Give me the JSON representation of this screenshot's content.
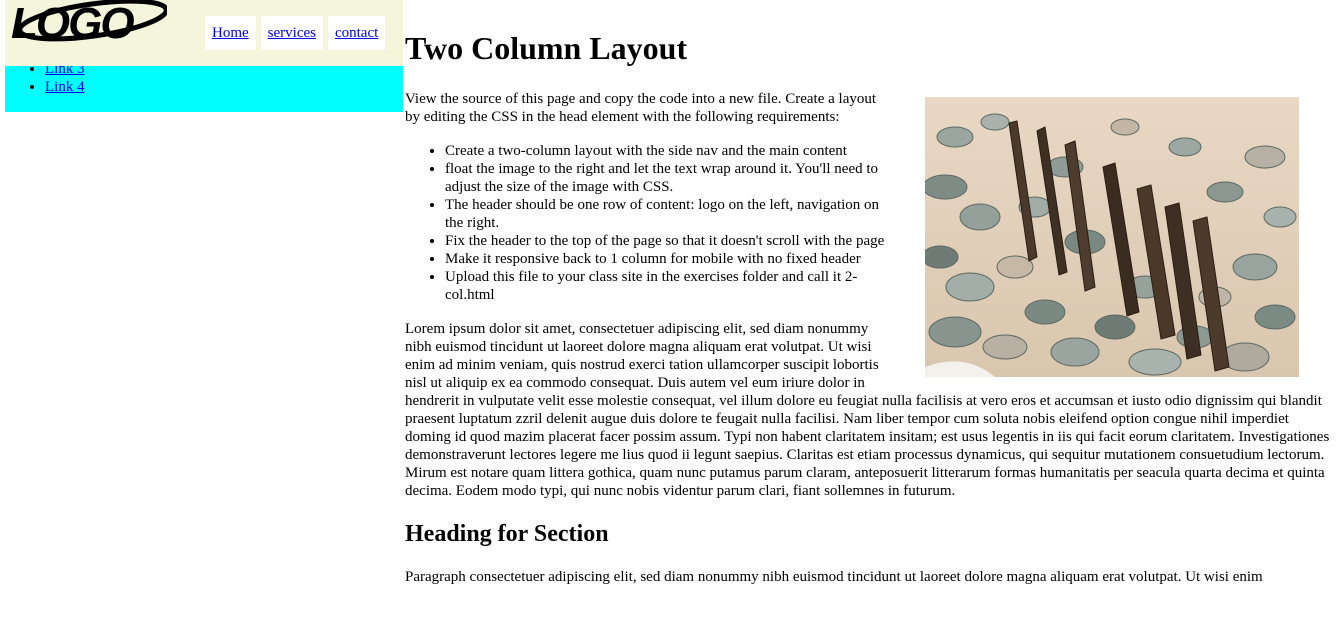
{
  "header": {
    "logo_text": "LOGO",
    "nav": [
      "Home",
      "services",
      "contact"
    ]
  },
  "sidenav": {
    "links": [
      "Link 3",
      "Link 4"
    ]
  },
  "main": {
    "title": "Two Column Layout",
    "intro": "View the source of this page and copy the code into a new file. Create a layout by editing the CSS in the head element with the following requirements:",
    "requirements": [
      "Create a two-column layout with the side nav and the main content",
      "float the image to the right and let the text wrap around it. You'll need to adjust the size of the image with CSS.",
      "The header should be one row of content: logo on the left, navigation on the right.",
      "Fix the header to the top of the page so that it doesn't scroll with the page",
      "Make it responsive back to 1 column for mobile with no fixed header",
      "Upload this file to your class site in the exercises folder and call it 2-col.html"
    ],
    "lorem": "Lorem ipsum dolor sit amet, consectetuer adipiscing elit, sed diam nonummy nibh euismod tincidunt ut laoreet dolore magna aliquam erat volutpat. Ut wisi enim ad minim veniam, quis nostrud exerci tation ullamcorper suscipit lobortis nisl ut aliquip ex ea commodo consequat. Duis autem vel eum iriure dolor in hendrerit in vulputate velit esse molestie consequat, vel illum dolore eu feugiat nulla facilisis at vero eros et accumsan et iusto odio dignissim qui blandit praesent luptatum zzril delenit augue duis dolore te feugait nulla facilisi. Nam liber tempor cum soluta nobis eleifend option congue nihil imperdiet doming id quod mazim placerat facer possim assum. Typi non habent claritatem insitam; est usus legentis in iis qui facit eorum claritatem. Investigationes demonstraverunt lectores legere me lius quod ii legunt saepius. Claritas est etiam processus dynamicus, qui sequitur mutationem consuetudium lectorum. Mirum est notare quam littera gothica, quam nunc putamus parum claram, anteposuerit litterarum formas humanitatis per seacula quarta decima et quinta decima. Eodem modo typi, qui nunc nobis videntur parum clari, fiant sollemnes in futurum.",
    "section_heading": "Heading for Section",
    "section_para": "Paragraph consectetuer adipiscing elit, sed diam nonummy nibh euismod tincidunt ut laoreet dolore magna aliquam erat volutpat. Ut wisi enim"
  },
  "icons": {
    "logo": "logo-mark",
    "photo": "beach-posts-photo"
  },
  "colors": {
    "header_bg": "#f5f5dc",
    "sidenav_bg": "#00ffff",
    "link": "#0000ee"
  }
}
